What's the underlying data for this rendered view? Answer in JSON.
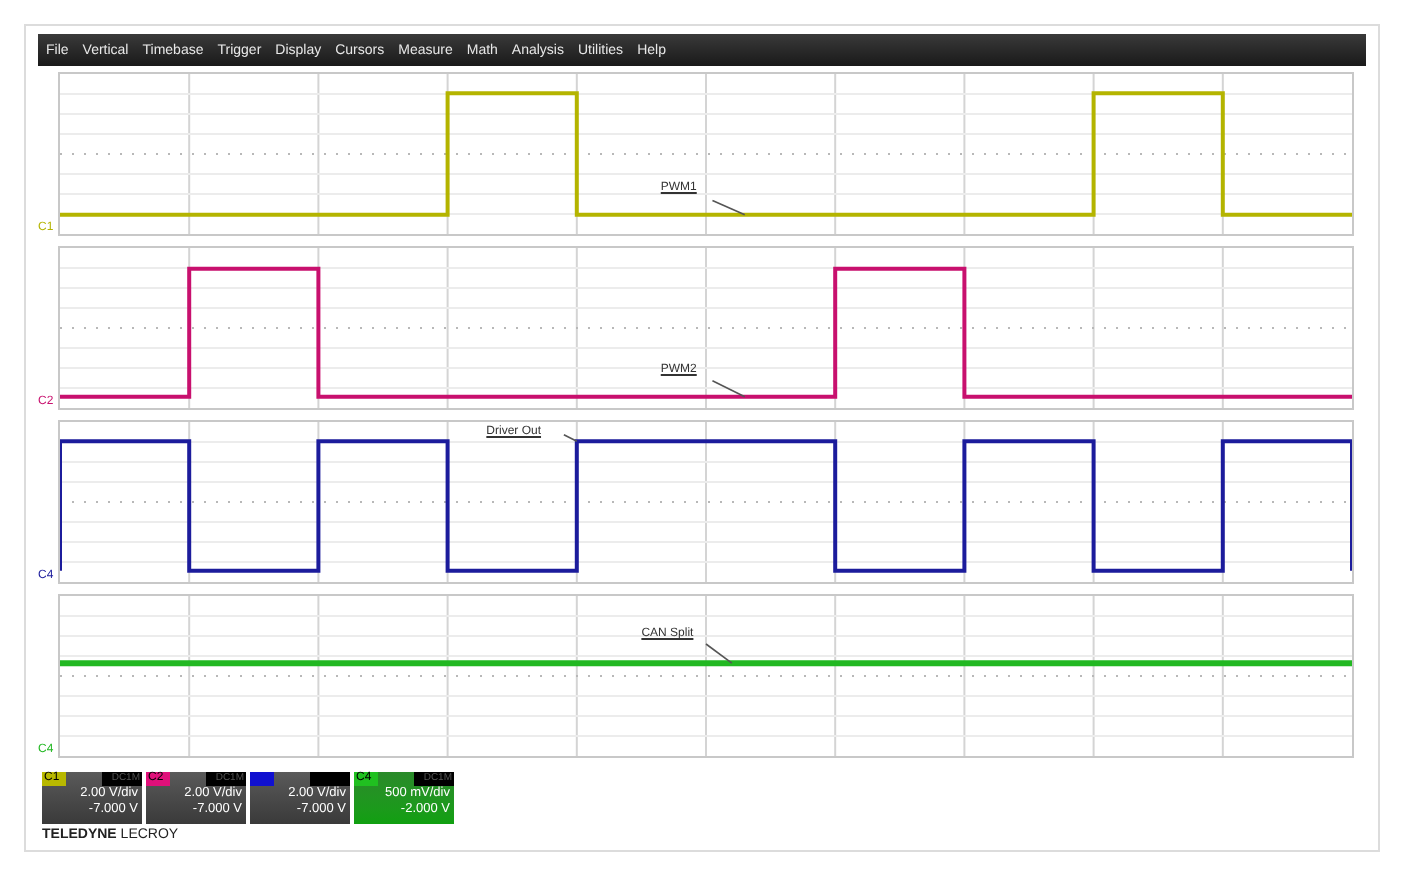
{
  "menu": [
    "File",
    "Vertical",
    "Timebase",
    "Trigger",
    "Display",
    "Cursors",
    "Measure",
    "Math",
    "Analysis",
    "Utilities",
    "Help"
  ],
  "traces": [
    {
      "channel": "C1",
      "label": "PWM1",
      "color": "#b4b400"
    },
    {
      "channel": "C2",
      "label": "PWM2",
      "color": "#c8106e"
    },
    {
      "channel": "C4",
      "label": "Driver Out",
      "color": "#1c1c9c"
    },
    {
      "channel": "C4",
      "label": "CAN Split",
      "color": "#22b822"
    }
  ],
  "channels": [
    {
      "name": "C1",
      "coupling": "DC1M",
      "scale": "2.00 V/div",
      "offset": "-7.000 V",
      "color": "#b8b800"
    },
    {
      "name": "C2",
      "coupling": "DC1M",
      "scale": "2.00 V/div",
      "offset": "-7.000 V",
      "color": "#e0107a"
    },
    {
      "scale": "2.00 V/div",
      "offset": "-7.000 V",
      "color": "#1010d0"
    },
    {
      "name": "C4",
      "coupling": "DC1M",
      "scale": "500 mV/div",
      "offset": "-2.000 V",
      "color": "#20c020"
    }
  ],
  "brand": {
    "bold": "TELEDYNE",
    "light": "LECROY"
  }
}
